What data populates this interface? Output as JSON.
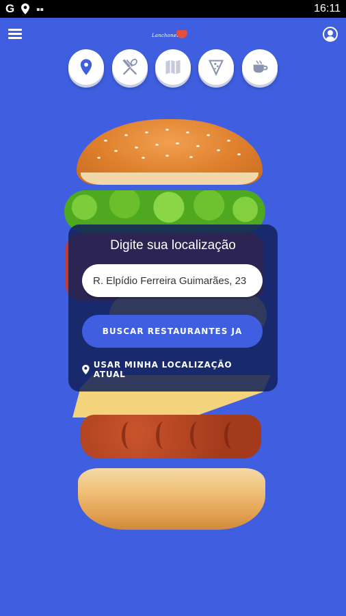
{
  "status_bar": {
    "left_icons": [
      "google-icon",
      "location-icon",
      "notification-icon"
    ],
    "time": "16:11"
  },
  "app": {
    "logo_text": "Lanchonet",
    "menu_icon": "hamburger-menu-icon",
    "account_icon": "user-account-icon"
  },
  "categories": [
    {
      "id": "location",
      "icon": "map-pin-icon"
    },
    {
      "id": "restaurants",
      "icon": "fork-spoon-icon"
    },
    {
      "id": "map",
      "icon": "map-icon"
    },
    {
      "id": "pizza",
      "icon": "pizza-slice-icon"
    },
    {
      "id": "coffee",
      "icon": "coffee-cup-icon"
    }
  ],
  "search": {
    "title": "Digite sua localização",
    "address_value": "R. Elpídio Ferreira Guimarães, 23",
    "search_button": "BUSCAR RESTAURANTES JA",
    "use_location": "USAR MINHA LOCALIZAÇÃO ATUAL"
  },
  "colors": {
    "background": "#3f5fe0",
    "accent": "#3f5fe0",
    "card": "#12225a"
  }
}
